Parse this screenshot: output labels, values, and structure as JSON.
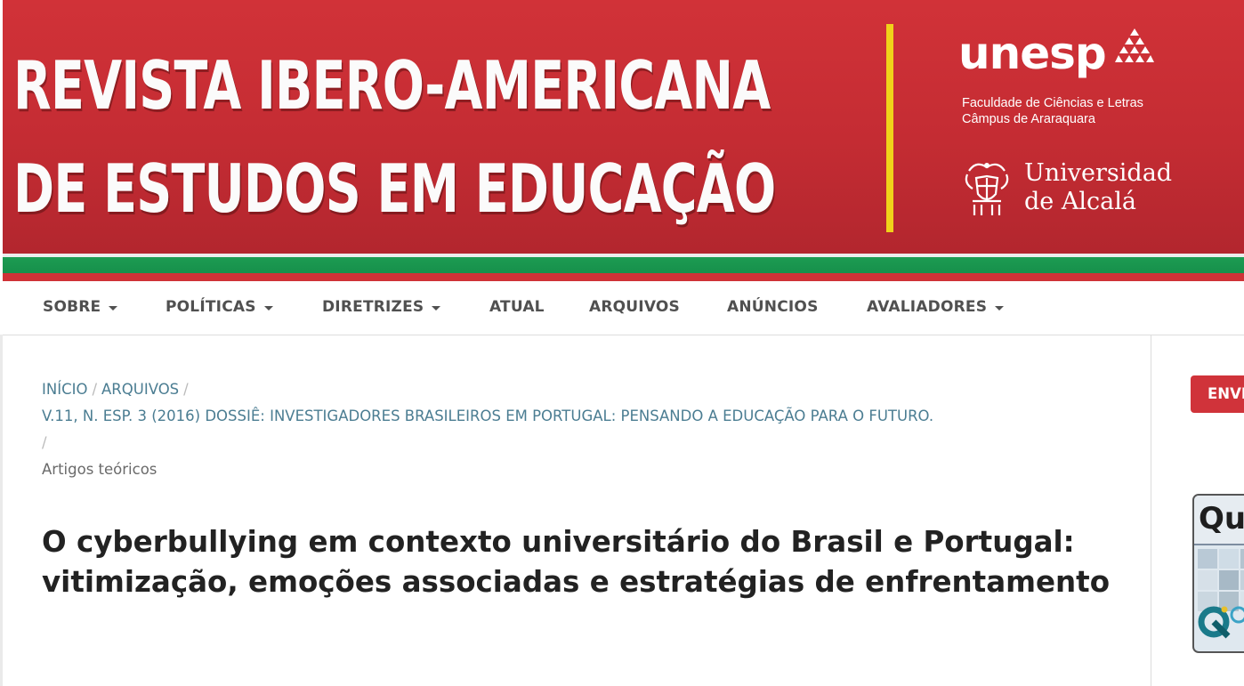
{
  "header": {
    "title_line1": "REVISTA IBERO-AMERICANA",
    "title_line2": "DE ESTUDOS EM EDUCAÇÃO",
    "unesp": {
      "name": "unesp",
      "faculty": "Faculdade de Ciências e Letras",
      "campus": "Câmpus de Araraquara"
    },
    "alcala": {
      "line1": "Universidad",
      "line2": "de Alcalá"
    }
  },
  "nav": {
    "items": [
      {
        "label": "SOBRE",
        "dropdown": true
      },
      {
        "label": "POLÍTICAS",
        "dropdown": true
      },
      {
        "label": "DIRETRIZES",
        "dropdown": true
      },
      {
        "label": "ATUAL",
        "dropdown": false
      },
      {
        "label": "ARQUIVOS",
        "dropdown": false
      },
      {
        "label": "ANÚNCIOS",
        "dropdown": false
      },
      {
        "label": "AVALIADORES",
        "dropdown": true
      }
    ]
  },
  "breadcrumb": {
    "home": "INÍCIO",
    "archives": "ARQUIVOS",
    "issue": "V.11, N. ESP. 3 (2016) DOSSIÊ: INVESTIGADORES BRASILEIROS EM PORTUGAL: PENSANDO A EDUCAÇÃO PARA O FUTURO.",
    "section": "Artigos teóricos",
    "separator": "/"
  },
  "article": {
    "title": "O cyberbullying em contexto universitário do Brasil e Portugal: vitimização, emoções associadas e estratégias de enfrentamento"
  },
  "sidebar": {
    "submit_label": "ENVIAR SUBMISSÃO",
    "qualis_label": "Qualis"
  },
  "colors": {
    "banner_red": "#c92e35",
    "stripe_green": "#1c9b52",
    "accent_yellow": "#f0d21a",
    "link_teal": "#4b7d92",
    "nav_text": "#505050",
    "button_red": "#d0333a"
  }
}
